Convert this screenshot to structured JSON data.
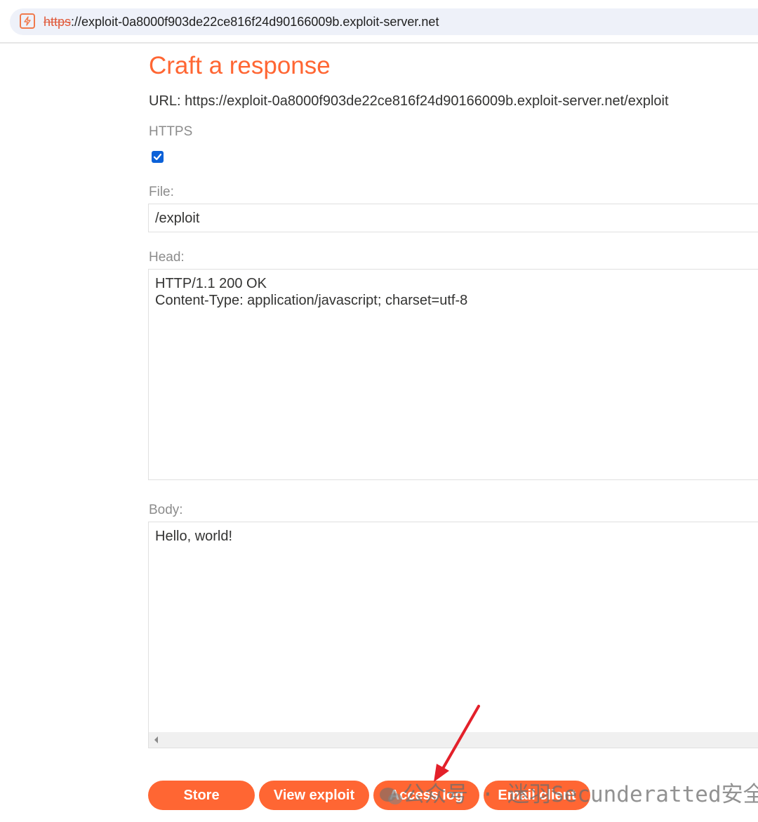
{
  "browser": {
    "url_scheme": "https",
    "url_rest": "://exploit-0a8000f903de22ce816f24d90166009b.exploit-server.net",
    "site_icon": "lightning-icon"
  },
  "page": {
    "title": "Craft a response",
    "url_label": "URL: https://exploit-0a8000f903de22ce816f24d90166009b.exploit-server.net/exploit",
    "https_label": "HTTPS",
    "https_checked": true,
    "file_label": "File:",
    "file_value": "/exploit",
    "head_label": "Head:",
    "head_value": "HTTP/1.1 200 OK\nContent-Type: application/javascript; charset=utf-8",
    "body_label": "Body:",
    "body_value": "Hello, world!"
  },
  "buttons": {
    "store": "Store",
    "view_exploit": "View exploit",
    "access_log": "Access log",
    "email_client": "Email client"
  },
  "overlay": {
    "watermark_text": "公众号 · 迷羽Secunderatted安全",
    "annotation": "red-arrow pointing to Access log button"
  },
  "colors": {
    "accent": "#ff6633",
    "checkbox": "#0b61d8",
    "arrow": "#e3202a"
  }
}
